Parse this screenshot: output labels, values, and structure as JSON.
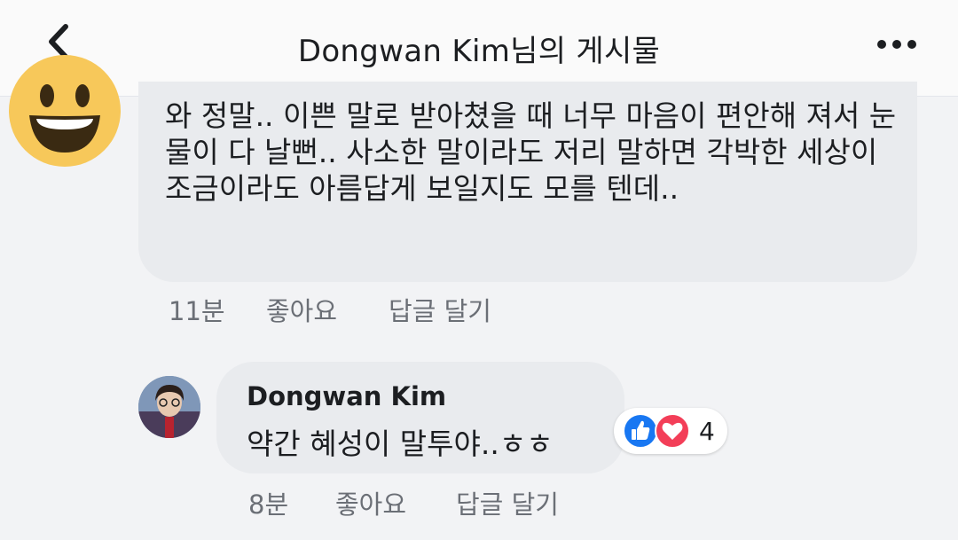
{
  "header": {
    "title": "Dongwan Kim님의 게시물"
  },
  "comment1": {
    "text": "와 정말.. 이쁜 말로 받아쳤을 때 너무 마음이 편안해 져서 눈물이 다 날뻔.. 사소한 말이라도 저리 말하면 각박한 세상이 조금이라도 아름답게 보일지도 모를 텐데..",
    "time": "11분",
    "like_label": "좋아요",
    "reply_label": "답글 달기"
  },
  "comment2": {
    "author": "Dongwan Kim",
    "text": "약간 혜성이 말투야..ㅎㅎ",
    "time": "8분",
    "like_label": "좋아요",
    "reply_label": "답글 달기",
    "reaction_count": "4"
  },
  "colors": {
    "like_blue": "#1877f2",
    "love_red": "#f33e58",
    "bubble_bg": "#e9ebee",
    "meta_gray": "#6b6f76"
  },
  "icons": [
    "back-chevron-icon",
    "more-dots-icon",
    "smiley-emoji-icon",
    "like-reaction-icon",
    "love-reaction-icon"
  ]
}
